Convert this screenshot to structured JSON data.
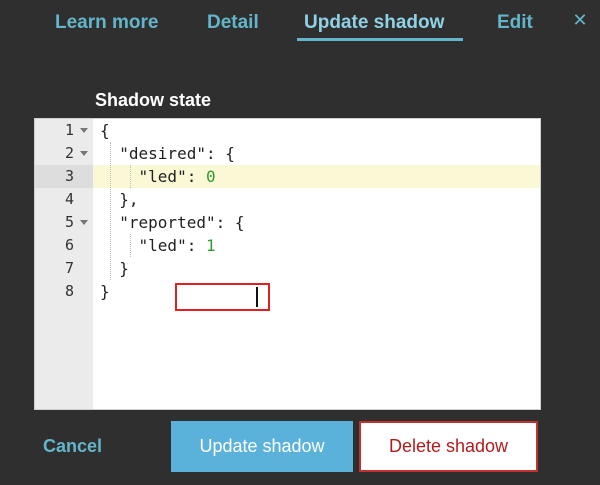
{
  "tabs": [
    {
      "label": "Learn more",
      "active": false
    },
    {
      "label": "Detail",
      "active": false
    },
    {
      "label": "Update shadow",
      "active": true
    },
    {
      "label": "Edit",
      "active": false
    }
  ],
  "close_icon": "close-icon",
  "section_title": "Shadow state",
  "editor": {
    "lines": [
      {
        "num": "1",
        "fold": true,
        "text": "{"
      },
      {
        "num": "2",
        "fold": true,
        "text": "  \"desired\": {"
      },
      {
        "num": "3",
        "fold": false,
        "text": "    \"led\": ",
        "value": "0",
        "active": true
      },
      {
        "num": "4",
        "fold": false,
        "text": "  },"
      },
      {
        "num": "5",
        "fold": true,
        "text": "  \"reported\": {"
      },
      {
        "num": "6",
        "fold": false,
        "text": "    \"led\": ",
        "value": "1"
      },
      {
        "num": "7",
        "fold": false,
        "text": "  }"
      },
      {
        "num": "8",
        "fold": false,
        "text": "}"
      }
    ]
  },
  "footer": {
    "cancel_label": "Cancel",
    "update_label": "Update shadow",
    "delete_label": "Delete shadow"
  },
  "colors": {
    "background": "#2f2f2f",
    "accent": "#63b6c9",
    "primary_button": "#5ab2db",
    "danger": "#c23030",
    "number": "#2e9c2e"
  }
}
